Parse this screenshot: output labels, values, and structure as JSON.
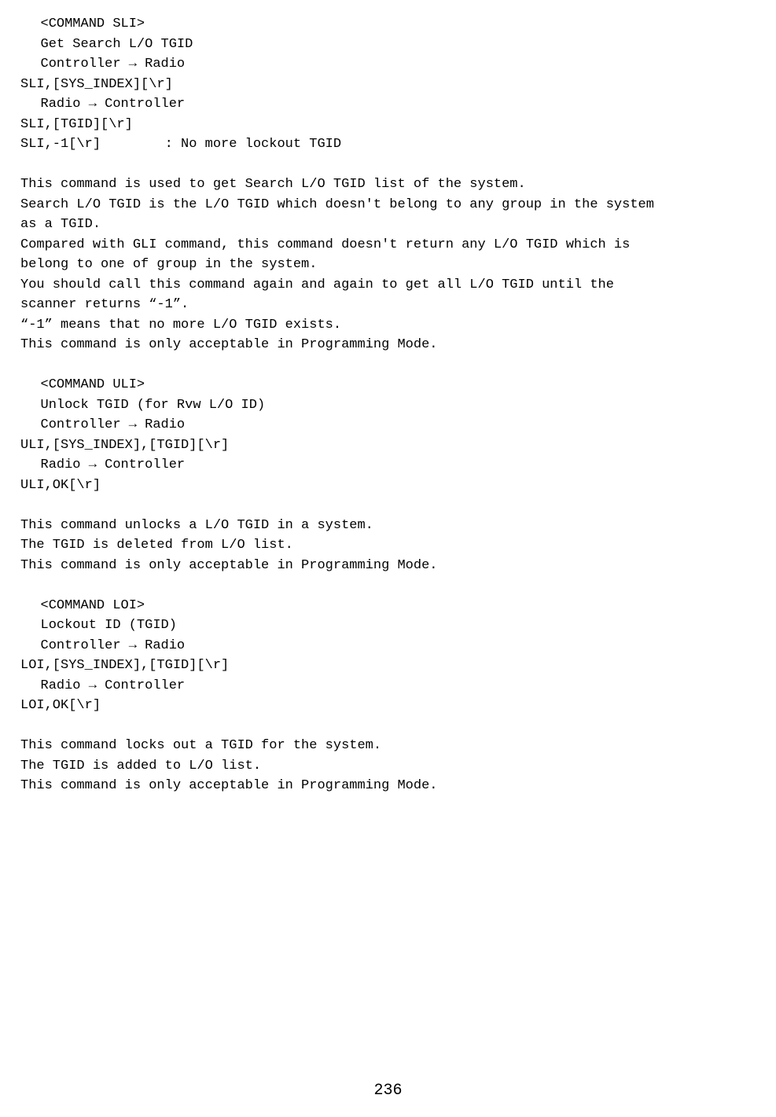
{
  "sli": {
    "header": "<COMMAND SLI>",
    "title": "Get Search L/O TGID",
    "cr": "Controller → Radio",
    "cr_cmd": "SLI,[SYS_INDEX][\\r]",
    "rc": "Radio → Controller",
    "rc_cmd": "SLI,[TGID][\\r]",
    "rc_note_cmd": "SLI,-1[\\r]",
    "rc_note_desc": ": No more lockout TGID",
    "desc": [
      "This command is used to get Search L/O TGID list of the system.",
      "Search L/O TGID is the L/O TGID which doesn't belong to any group in the system",
      "as a TGID.",
      "Compared with GLI command, this command doesn't return any L/O TGID which is",
      "belong to one of group in the system.",
      "You should call this command again and again to get all L/O TGID until the",
      "scanner returns “-1”.",
      "“-1” means that no more L/O TGID exists.",
      "This command is only acceptable in Programming Mode."
    ]
  },
  "uli": {
    "header": "<COMMAND ULI>",
    "title": "Unlock TGID (for Rvw L/O ID)",
    "cr": "Controller → Radio",
    "cr_cmd": "ULI,[SYS_INDEX],[TGID][\\r]",
    "rc": "Radio → Controller",
    "rc_cmd": "ULI,OK[\\r]",
    "desc": [
      "This command unlocks a L/O TGID in a system.",
      "The TGID is deleted from L/O list.",
      "This command is only acceptable in Programming Mode."
    ]
  },
  "loi": {
    "header": "<COMMAND LOI>",
    "title": "Lockout ID (TGID)",
    "cr": "Controller → Radio",
    "cr_cmd": "LOI,[SYS_INDEX],[TGID][\\r]",
    "rc": "Radio → Controller",
    "rc_cmd": "LOI,OK[\\r]",
    "desc": [
      "This command locks out a TGID for the system.",
      "The TGID is added to L/O list.",
      "This command is only acceptable in Programming Mode."
    ]
  },
  "page_number": "236"
}
